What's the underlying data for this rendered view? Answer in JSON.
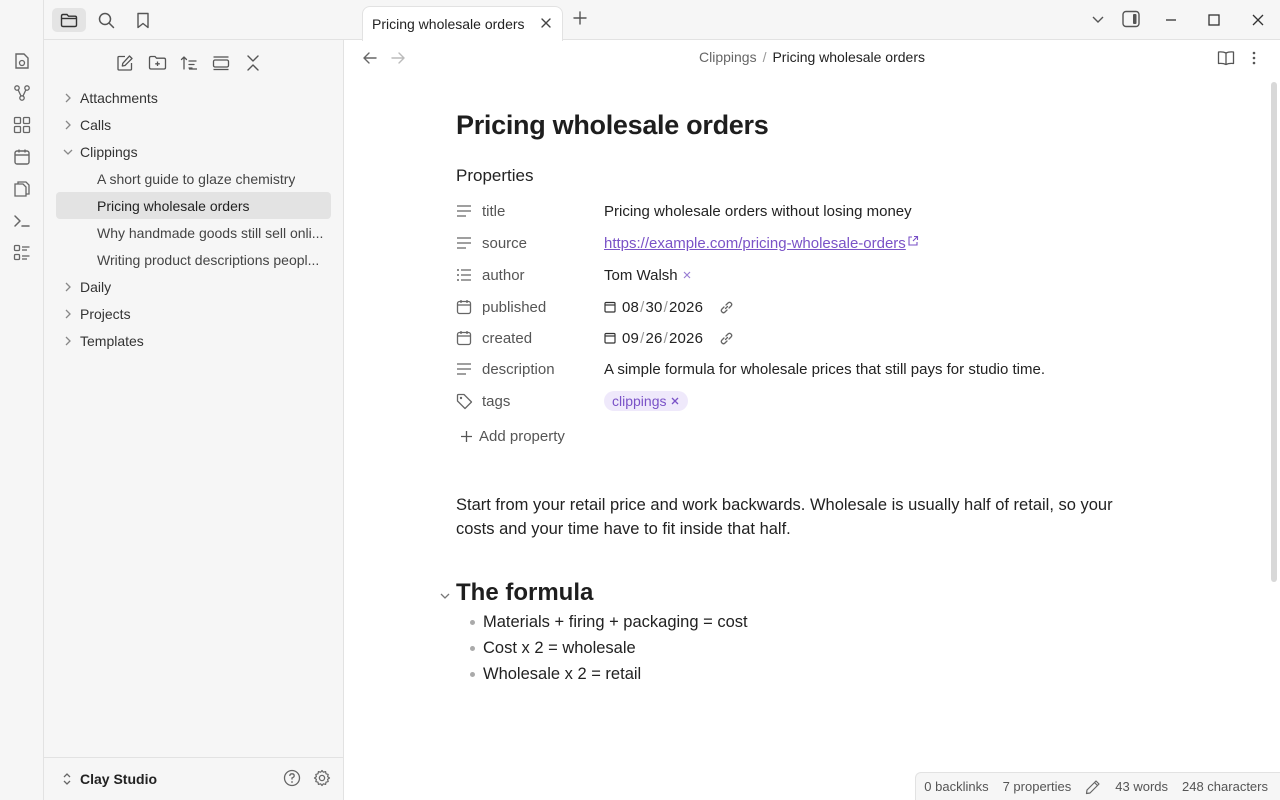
{
  "sidebar_header": {
    "icons": [
      "sidebar-toggle-icon",
      "folder-icon",
      "search-icon",
      "bookmark-icon"
    ]
  },
  "ribbon": {
    "icons": [
      "daily-note-icon",
      "graph-icon",
      "canvas-icon",
      "calendar-icon",
      "pages-icon",
      "terminal-icon",
      "list-icon"
    ]
  },
  "file_actions": [
    "new-note-icon",
    "new-folder-icon",
    "sort-icon",
    "collapse-view-icon",
    "collapse-all-icon"
  ],
  "tree": {
    "items": [
      {
        "label": "Attachments",
        "expanded": false
      },
      {
        "label": "Calls",
        "expanded": false
      },
      {
        "label": "Clippings",
        "expanded": true
      },
      {
        "label": "A short guide to glaze chemistry",
        "child": true
      },
      {
        "label": "Pricing wholesale orders",
        "child": true,
        "selected": true
      },
      {
        "label": "Why handmade goods still sell onli...",
        "child": true
      },
      {
        "label": "Writing product descriptions peopl...",
        "child": true
      },
      {
        "label": "Daily",
        "expanded": false
      },
      {
        "label": "Projects",
        "expanded": false
      },
      {
        "label": "Templates",
        "expanded": false
      }
    ]
  },
  "vault": {
    "name": "Clay Studio"
  },
  "tab": {
    "title": "Pricing wholesale orders"
  },
  "breadcrumb": {
    "parent": "Clippings",
    "separator": "/",
    "current": "Pricing wholesale orders"
  },
  "note": {
    "title": "Pricing wholesale orders",
    "properties_heading": "Properties",
    "properties": {
      "title": {
        "key": "title",
        "value": "Pricing wholesale orders without losing money"
      },
      "source": {
        "key": "source",
        "value": "https://example.com/pricing-wholesale-orders"
      },
      "author": {
        "key": "author",
        "value": "Tom Walsh"
      },
      "published": {
        "key": "published",
        "mm": "08",
        "dd": "30",
        "yyyy": "2026"
      },
      "created": {
        "key": "created",
        "mm": "09",
        "dd": "26",
        "yyyy": "2026"
      },
      "description": {
        "key": "description",
        "value": "A simple formula for wholesale prices that still pays for studio time."
      },
      "tags": {
        "key": "tags",
        "value": "clippings"
      }
    },
    "add_property": "Add property",
    "paragraph": "Start from your retail price and work backwards. Wholesale is usually half of retail, so your costs and your time have to fit inside that half.",
    "section_heading": "The formula",
    "bullets": [
      "Materials + firing + packaging = cost",
      "Cost x 2 = wholesale",
      "Wholesale x 2 = retail"
    ]
  },
  "status": {
    "backlinks": "0 backlinks",
    "properties": "7 properties",
    "words": "43 words",
    "characters": "248 characters"
  },
  "colors": {
    "accent": "#7a52c7",
    "tag_bg": "#efe9fb",
    "sidebar_bg": "#f6f6f6"
  }
}
